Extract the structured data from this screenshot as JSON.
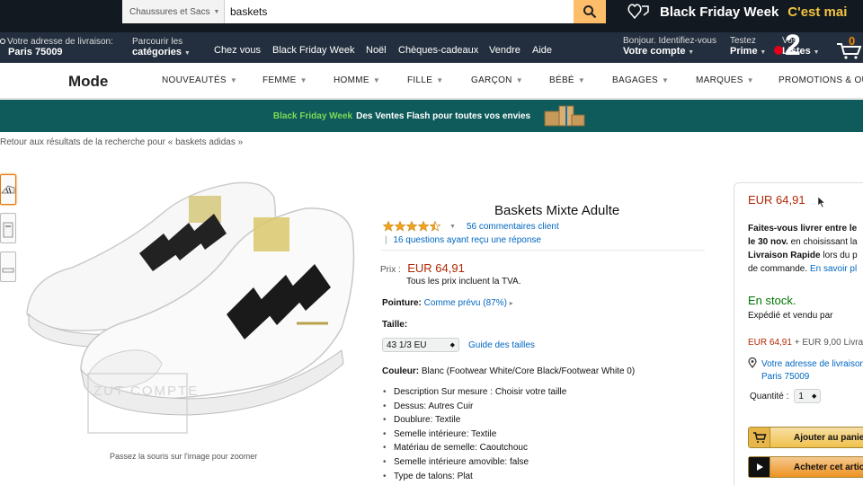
{
  "header": {
    "search_category": "Chaussures et Sacs",
    "search_value": "baskets",
    "promo_white": "Black Friday Week",
    "promo_yellow": "C'est mai"
  },
  "nav": {
    "delivery_line1": "Votre adresse de livraison:",
    "delivery_line2": "Paris 75009",
    "browse_line1": "Parcourir les",
    "browse_line2": "catégories",
    "links": [
      "Chez vous",
      "Black Friday Week",
      "Noël",
      "Chèques-cadeaux",
      "Vendre",
      "Aide"
    ],
    "account_line1": "Bonjour. Identifiez-vous",
    "account_line2": "Votre compte",
    "prime_line1": "Testez",
    "prime_line2": "Prime",
    "lists_line1": "Vos",
    "lists_line2": "Listes",
    "cart_count": "0",
    "tv_logo": "2"
  },
  "mode": {
    "title": "Mode",
    "items": [
      "NOUVEAUTÉS",
      "FEMME",
      "HOMME",
      "FILLE",
      "GARÇON",
      "BÉBÉ",
      "BAGAGES",
      "MARQUES",
      "PROMOTIONS & OU"
    ]
  },
  "banner": {
    "green": "Black Friday Week",
    "white": "Des Ventes Flash pour toutes vos envies"
  },
  "breadcrumb": "Retour aux résultats de la recherche pour « baskets adidas »",
  "gallery": {
    "zoom_hint": "Passez la souris sur l'image pour zoomer",
    "watermark": "ZUT COMPTE"
  },
  "product": {
    "title": "Baskets Mixte Adulte",
    "rating": 4.5,
    "reviews": "56 commentaires client",
    "questions": "16 questions ayant reçu une réponse",
    "price_label": "Prix :",
    "price": "EUR 64,91",
    "vat_note": "Tous les prix incluent la TVA.",
    "fit_label": "Pointure:",
    "fit_value": "Comme prévu (87%)",
    "size_label": "Taille:",
    "size_value": "43 1/3 EU",
    "size_guide": "Guide des tailles",
    "color_label": "Couleur:",
    "color_value": "Blanc (Footwear White/Core Black/Footwear White 0)",
    "features": [
      "Description Sur mesure : Choisir votre taille",
      "Dessus: Autres Cuir",
      "Doublure: Textile",
      "Semelle intérieure: Textile",
      "Matériau de semelle: Caoutchouc",
      "Semelle intérieure amovible: false",
      "Type de talons: Plat"
    ]
  },
  "buybox": {
    "price": "EUR 64,91",
    "delivery_line1_bold": "Faites-vous livrer entre le",
    "delivery_line2_bold": "le 30 nov.",
    "delivery_line2_rest": " en choisissant la",
    "delivery_line3_bold": "Livraison Rapide",
    "delivery_line3_rest": " lors du p",
    "delivery_line4": "de commande. ",
    "delivery_line4_link": "En savoir pl",
    "stock": "En stock.",
    "sold_by": "Expédié et vendu par",
    "price_shipping_red": "EUR 64,91",
    "price_shipping_rest": " + EUR 9,00 Livrai",
    "address_line1": "Votre adresse de livraison",
    "address_line2": "Paris 75009",
    "qty_label": "Quantité :",
    "qty_value": "1",
    "add_to_cart": "Ajouter au panie",
    "buy_now": "Acheter cet artic"
  },
  "colors": {
    "amazon_dark": "#131921",
    "nav_blue": "#232f3e",
    "search_orange": "#febd69",
    "banner_teal": "#0f5a5a",
    "price_red": "#b12704",
    "stock_green": "#007600",
    "link_blue": "#0066c0"
  }
}
